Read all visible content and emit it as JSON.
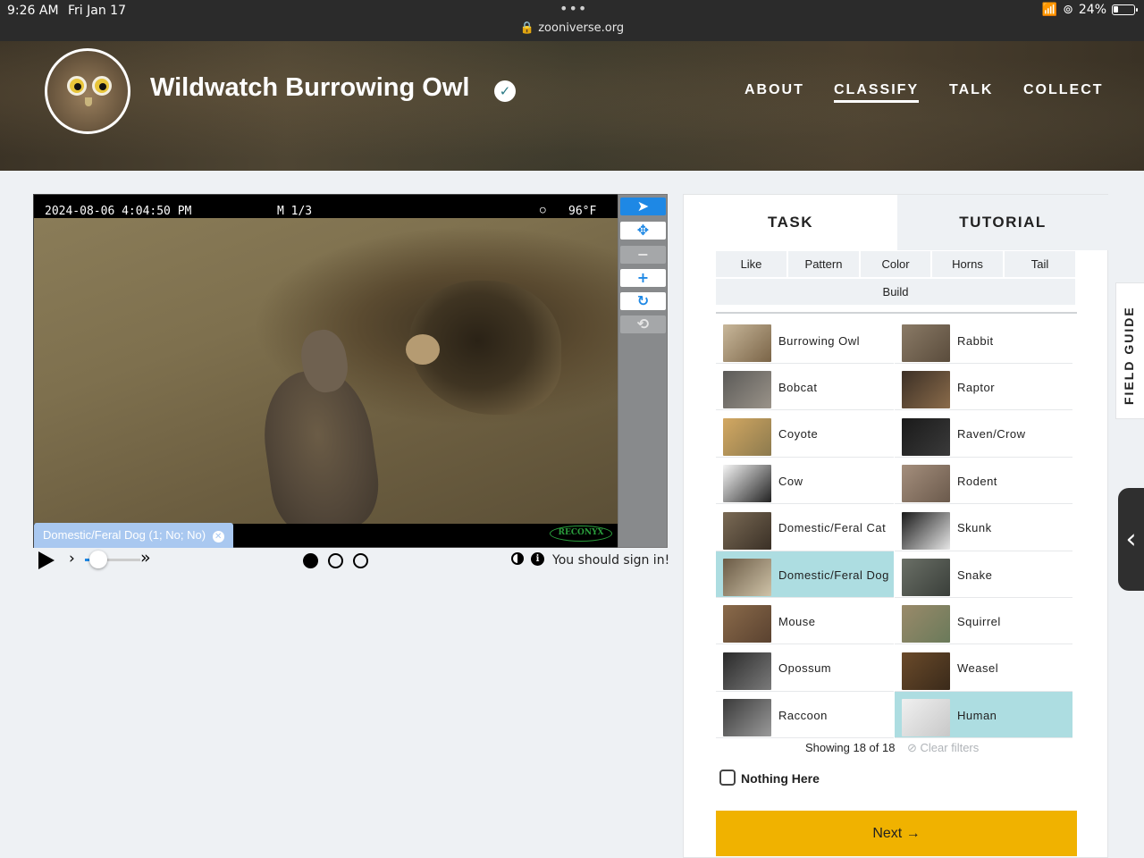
{
  "status_bar": {
    "time": "9:26 AM",
    "date": "Fri Jan 17",
    "url": "zooniverse.org",
    "battery": "24%"
  },
  "project": {
    "title": "Wildwatch Burrowing Owl",
    "nav": [
      "ABOUT",
      "CLASSIFY",
      "TALK",
      "COLLECT"
    ],
    "active_nav": "CLASSIFY"
  },
  "viewer": {
    "timestamp": "2024-08-06 4:04:50 PM",
    "mode": "M 1/3",
    "temperature": "96°F",
    "watermark": "RECONYX",
    "annotation_tag": "Domestic/Feral Dog (1; No; No)",
    "frames_total": 3,
    "current_frame": 1,
    "sign_in_message": "You should sign in!"
  },
  "toolbar": {
    "tools": [
      "pointer-icon",
      "move-icon",
      "zoom-out-icon",
      "zoom-in-icon",
      "rotate-icon",
      "reset-icon"
    ]
  },
  "task_panel": {
    "tabs": [
      "TASK",
      "TUTORIAL"
    ],
    "filters": [
      "Like",
      "Pattern",
      "Color",
      "Horns",
      "Tail",
      "Build"
    ],
    "choices": [
      {
        "label": "Burrowing Owl",
        "selected": false
      },
      {
        "label": "Rabbit",
        "selected": false
      },
      {
        "label": "Bobcat",
        "selected": false
      },
      {
        "label": "Raptor",
        "selected": false
      },
      {
        "label": "Coyote",
        "selected": false
      },
      {
        "label": "Raven/Crow",
        "selected": false
      },
      {
        "label": "Cow",
        "selected": false
      },
      {
        "label": "Rodent",
        "selected": false
      },
      {
        "label": "Domestic/Feral Cat",
        "selected": false
      },
      {
        "label": "Skunk",
        "selected": false
      },
      {
        "label": "Domestic/Feral Dog",
        "selected": true
      },
      {
        "label": "Snake",
        "selected": false
      },
      {
        "label": "Mouse",
        "selected": false
      },
      {
        "label": "Squirrel",
        "selected": false
      },
      {
        "label": "Opossum",
        "selected": false
      },
      {
        "label": "Weasel",
        "selected": false
      },
      {
        "label": "Raccoon",
        "selected": false
      },
      {
        "label": "Human",
        "selected": true
      }
    ],
    "showing": "Showing 18 of 18",
    "clear_filters": "Clear filters",
    "nothing_here": "Nothing Here",
    "next_label": "Next →"
  },
  "field_guide": {
    "label": "FIELD GUIDE"
  },
  "colors": {
    "accent": "#1e88e5",
    "selected_choice": "#addde1",
    "next_button": "#f0b200",
    "tag": "#a9c8f0"
  }
}
